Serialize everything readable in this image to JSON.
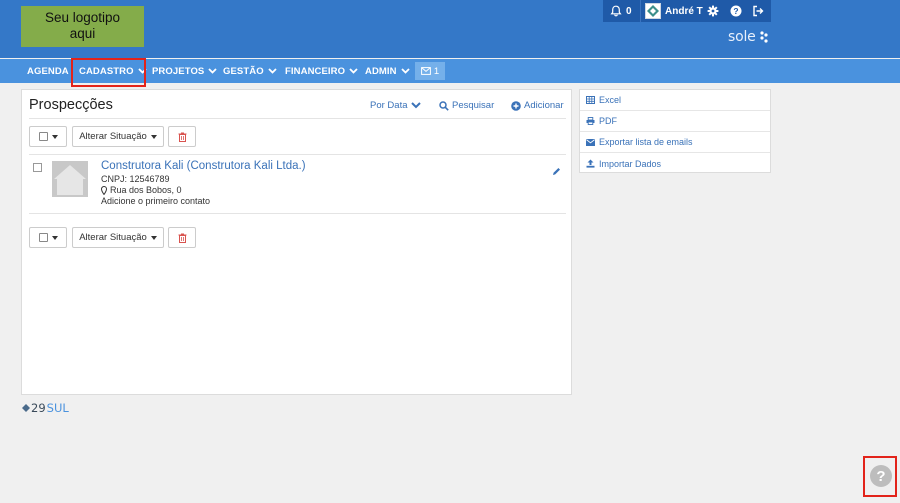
{
  "header": {
    "logo_line1": "Seu logotipo",
    "logo_line2": "aqui",
    "notifications_count": "0",
    "user_name": "André T",
    "brand": "sole"
  },
  "nav": {
    "items": [
      {
        "label": "AGENDA"
      },
      {
        "label": "CADASTRO"
      },
      {
        "label": "PROJETOS"
      },
      {
        "label": "GESTÃO"
      },
      {
        "label": "FINANCEIRO"
      },
      {
        "label": "ADMIN"
      }
    ],
    "mail_count": "1"
  },
  "panel": {
    "title": "Prospecções",
    "order_label": "Por Data",
    "search_label": "Pesquisar",
    "add_label": "Adicionar",
    "bulk_action_label": "Alterar Situação"
  },
  "record": {
    "name": "Construtora Kali (Construtora Kali Ltda.)",
    "cnpj": "CNPJ: 12546789",
    "address": "Rua dos Bobos, 0",
    "contact_hint": "Adicione o primeiro contato"
  },
  "side": {
    "items": [
      {
        "label": "Excel",
        "icon": "table-icon"
      },
      {
        "label": "PDF",
        "icon": "print-icon"
      },
      {
        "label": "Exportar lista de emails",
        "icon": "envelope-icon"
      },
      {
        "label": "Importar Dados",
        "icon": "upload-icon"
      }
    ]
  },
  "footer": {
    "brand_num": "29",
    "brand_word": "SUL"
  },
  "help": {
    "symbol": "?"
  },
  "colors": {
    "header_bg": "#3478c8",
    "nav_bg": "#4a92de",
    "accent": "#3a72b8",
    "highlight": "#e2231a",
    "logo_bg": "#84ac4a"
  }
}
